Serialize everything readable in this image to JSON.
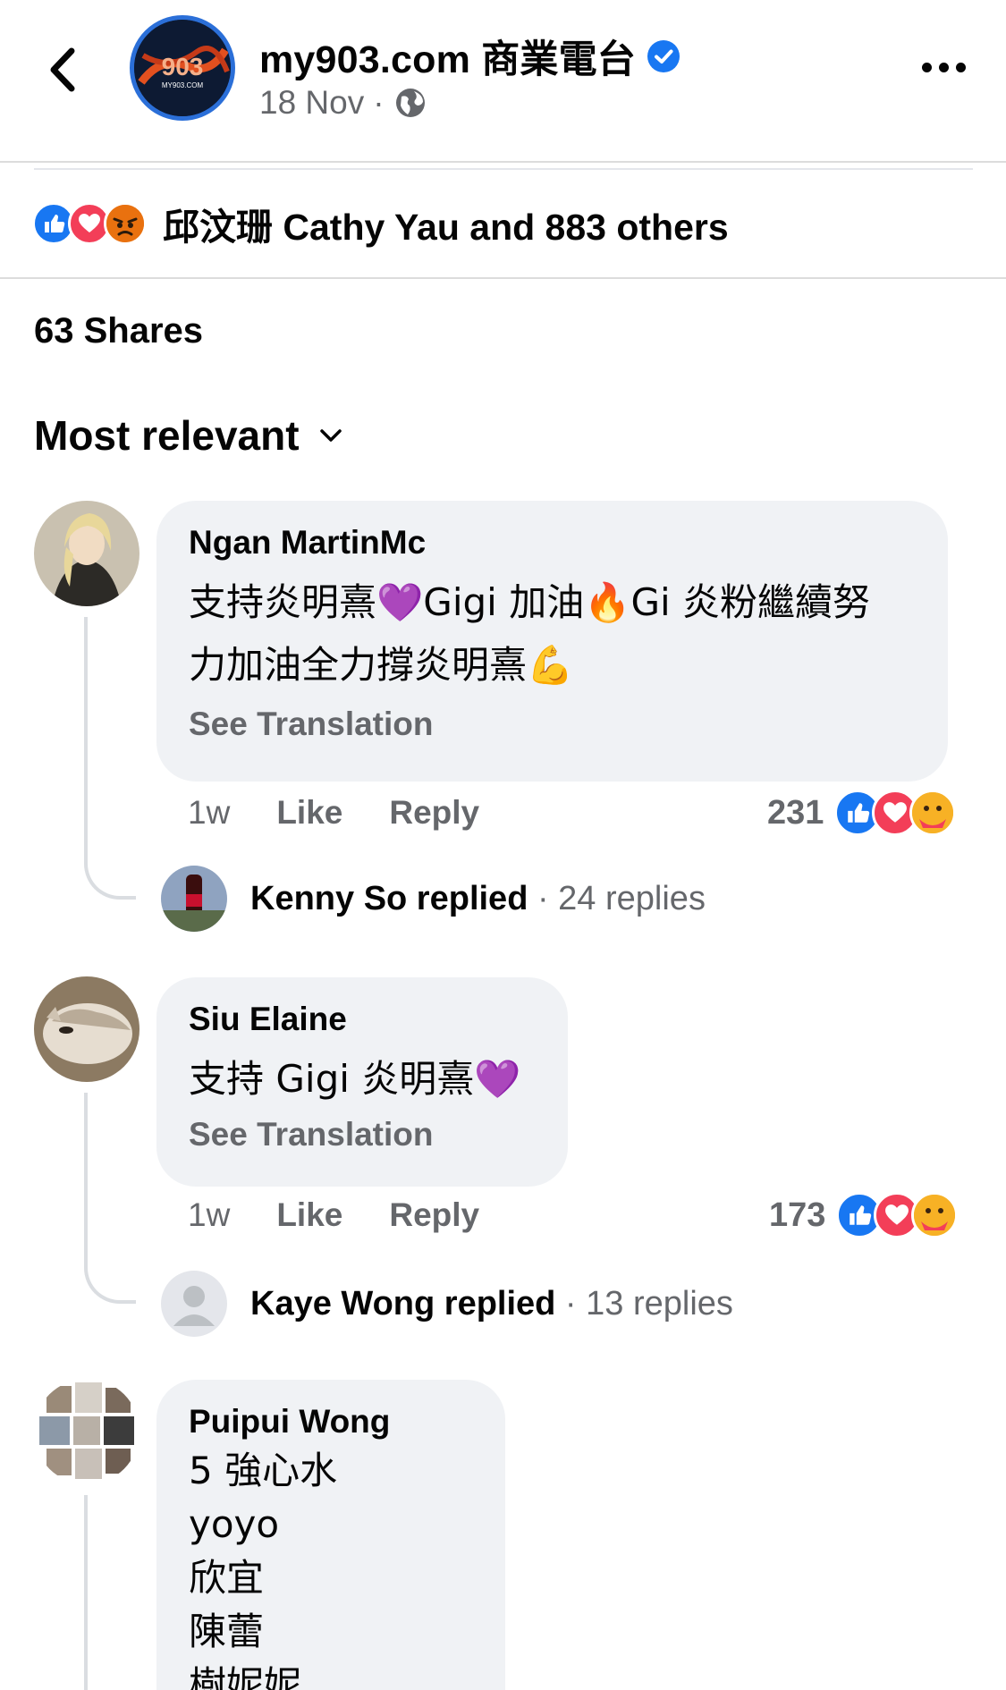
{
  "header": {
    "page_name": "my903.com 商業電台",
    "date": "18 Nov",
    "separator": "·",
    "avatar_logo_text": "903",
    "avatar_logo_subtext": "MY903.COM"
  },
  "reactions_summary": {
    "icons": [
      "like-icon",
      "love-icon",
      "angry-icon"
    ],
    "text": "邱汶珊 Cathy Yau and 883 others"
  },
  "shares": "63 Shares",
  "sort": {
    "label": "Most relevant"
  },
  "colors": {
    "verified": "#1877f2",
    "like": "#1877f2",
    "love": "#f33e58",
    "angry": "#e9710f",
    "care": "#f7b125",
    "muted": "#65676b",
    "bubble": "#f0f2f5"
  },
  "comments": [
    {
      "name": "Ngan MartinMc",
      "text_line1": "支持炎明熹💜Gigi 加油🔥Gi 炎粉繼續努",
      "text_line2": "力加油全力撐炎明熹💪",
      "see_translation": "See Translation",
      "time": "1w",
      "like": "Like",
      "reply": "Reply",
      "reaction_count": "231",
      "reply_summary": {
        "name": "Kenny So",
        "verb": " replied",
        "count": " · 24 replies"
      }
    },
    {
      "name": "Siu Elaine",
      "text_line1": "支持 Gigi 炎明熹💜",
      "see_translation": "See Translation",
      "time": "1w",
      "like": "Like",
      "reply": "Reply",
      "reaction_count": "173",
      "reply_summary": {
        "name": "Kaye Wong",
        "verb": " replied",
        "count": " · 13 replies"
      }
    },
    {
      "name": "Puipui Wong",
      "lines": [
        "5 強心水",
        "yoyo",
        "欣宜",
        "陳蕾",
        "樹妮妮"
      ]
    }
  ]
}
